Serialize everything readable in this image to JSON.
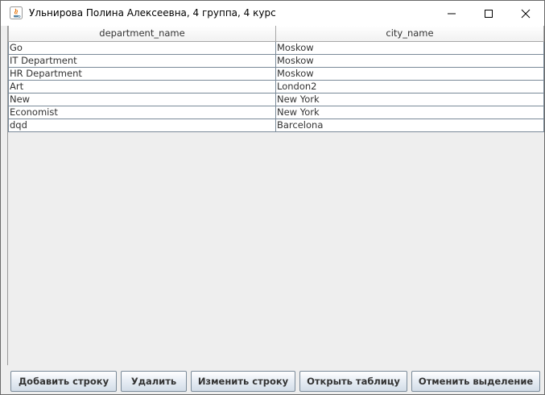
{
  "window": {
    "title": "Ульнирова Полина Алексеевна, 4 группа, 4 курс",
    "icon": "java-cup-icon"
  },
  "table": {
    "columns": [
      "department_name",
      "city_name"
    ],
    "rows": [
      [
        "Go",
        "Moskow"
      ],
      [
        "IT Department",
        "Moskow"
      ],
      [
        "HR Department",
        "Moskow"
      ],
      [
        "Art",
        "London2"
      ],
      [
        "New",
        "New York"
      ],
      [
        "Economist",
        "New York"
      ],
      [
        "dqd",
        "Barcelona"
      ]
    ]
  },
  "buttons": {
    "add_row": "Добавить строку",
    "delete": "Удалить",
    "edit_row": "Изменить строку",
    "open_table": "Открыть таблицу",
    "clear_selection": "Отменить выделение"
  },
  "colors": {
    "window_bg": "#eeeeee",
    "cell_border": "#7a8a99",
    "button_gradient_bottom": "#d3dde8"
  }
}
